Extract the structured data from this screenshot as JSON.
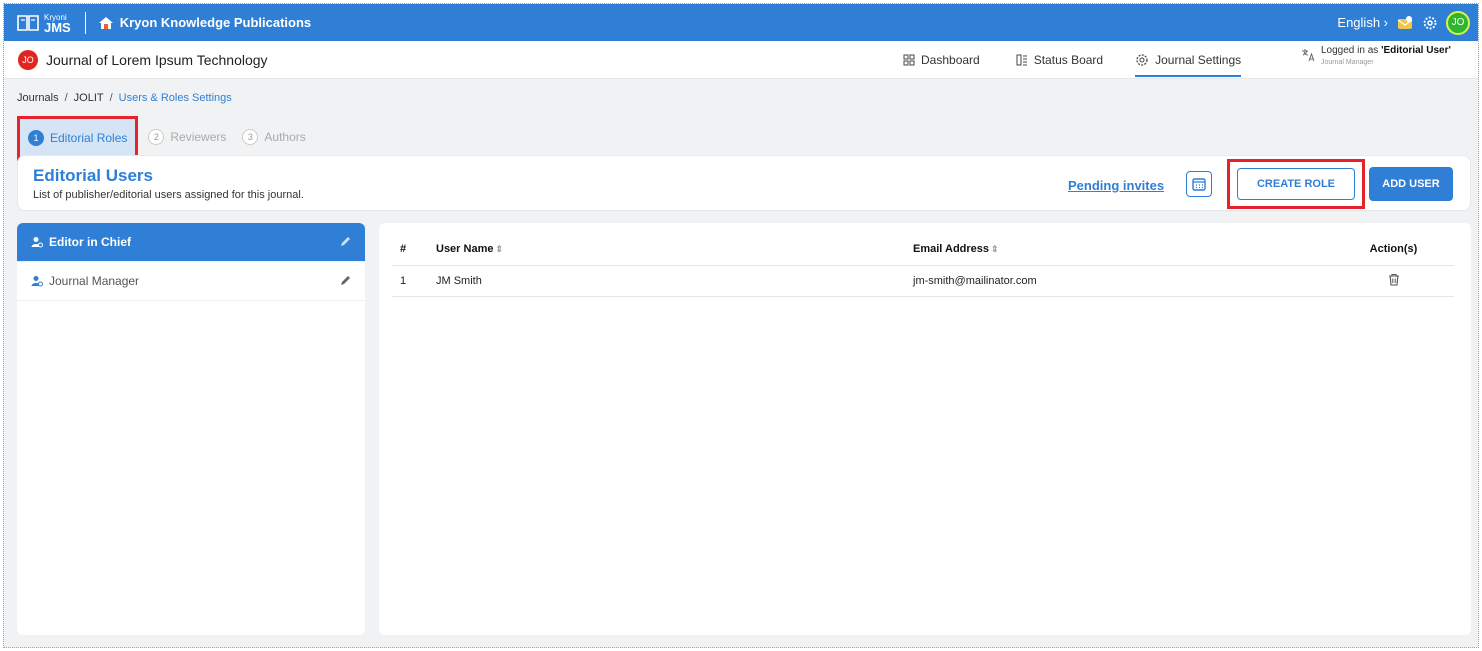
{
  "topbar": {
    "logo_small": "Kryoni",
    "logo_big": "JMS",
    "org_title": "Kryon Knowledge Publications",
    "language": "English",
    "user_initials": "JO"
  },
  "header": {
    "journal_initials": "JO",
    "journal_title": "Journal of Lorem Ipsum Technology",
    "nav": [
      {
        "label": "Dashboard",
        "icon": "grid-icon"
      },
      {
        "label": "Status Board",
        "icon": "board-icon"
      },
      {
        "label": "Journal Settings",
        "icon": "gear-icon"
      }
    ],
    "logged_prefix": "Logged in as",
    "logged_user": "'Editorial User'",
    "logged_role": "Journal Manager"
  },
  "breadcrumb": {
    "items": [
      "Journals",
      "JOLIT",
      "Users & Roles Settings"
    ]
  },
  "steps": [
    {
      "num": "1",
      "label": "Editorial Roles"
    },
    {
      "num": "2",
      "label": "Reviewers"
    },
    {
      "num": "3",
      "label": "Authors"
    }
  ],
  "users_card": {
    "title": "Editorial Users",
    "subtitle": "List of publisher/editorial users assigned for this journal.",
    "pending_label": "Pending invites",
    "create_role_label": "CREATE ROLE",
    "add_user_label": "ADD USER"
  },
  "roles": [
    {
      "label": "Editor in Chief"
    },
    {
      "label": "Journal Manager"
    }
  ],
  "table": {
    "headers": [
      "#",
      "User Name",
      "Email Address",
      "Action(s)"
    ],
    "rows": [
      {
        "num": "1",
        "name": "JM Smith",
        "email": "jm-smith@mailinator.com"
      }
    ]
  },
  "colors": {
    "accent": "#2f7fd6",
    "highlight": "#e8222a"
  }
}
